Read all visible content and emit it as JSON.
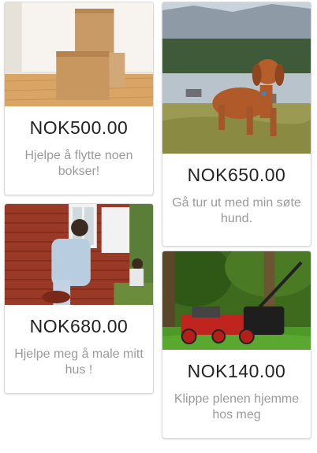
{
  "listings": [
    {
      "price": "NOK500.00",
      "description": "Hjelpe å flytte noen bokser!",
      "image": "moving-boxes-photo"
    },
    {
      "price": "NOK650.00",
      "description": "Gå tur ut med min søte hund.",
      "image": "puppy-photo"
    },
    {
      "price": "NOK680.00",
      "description": "Hjelpe meg å male mitt hus !",
      "image": "house-painting-photo"
    },
    {
      "price": "NOK140.00",
      "description": "Klippe plenen hjemme hos meg",
      "image": "lawn-mower-photo"
    }
  ]
}
